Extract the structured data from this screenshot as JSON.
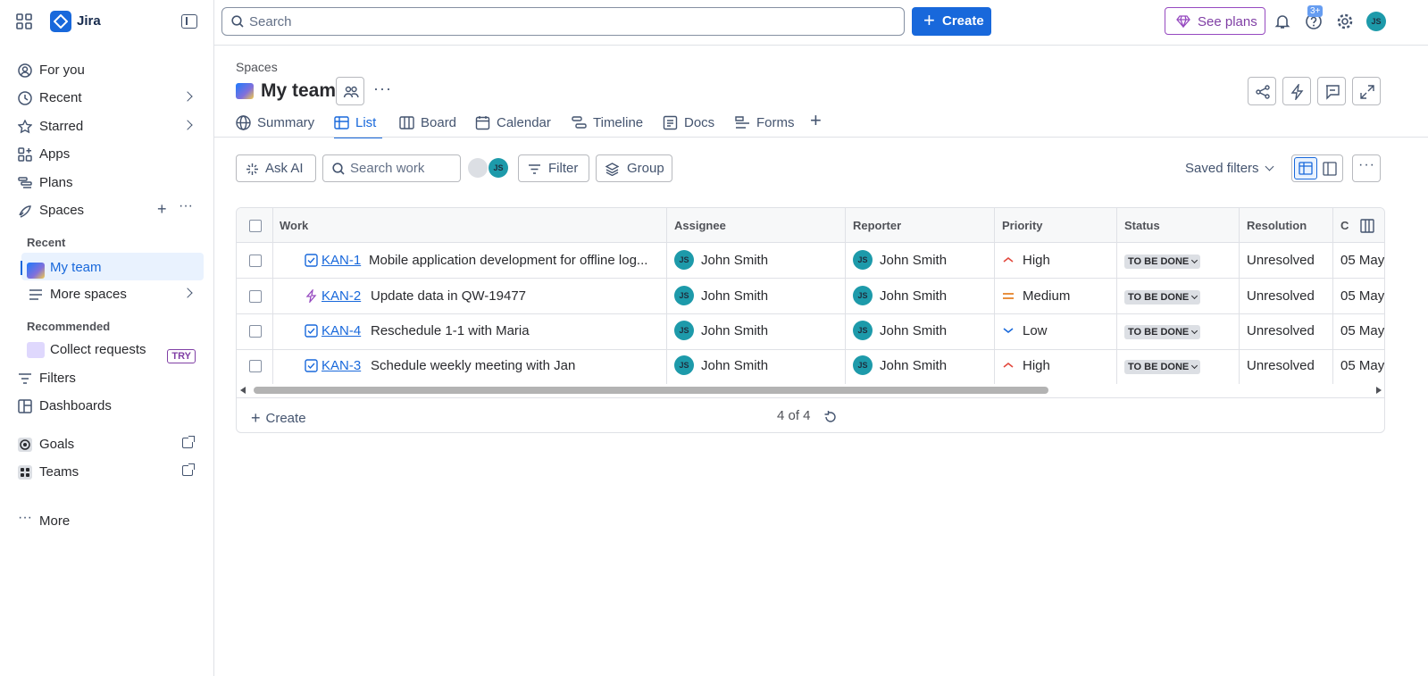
{
  "app": {
    "name": "Jira"
  },
  "sidebar": {
    "items": [
      {
        "label": "For you"
      },
      {
        "label": "Recent"
      },
      {
        "label": "Starred"
      },
      {
        "label": "Apps"
      },
      {
        "label": "Plans"
      },
      {
        "label": "Spaces"
      }
    ],
    "spaces_recent_label": "Recent",
    "current_space": "My team",
    "more_spaces": "More spaces",
    "recommended_label": "Recommended",
    "collect_requests": "Collect requests",
    "try_badge": "TRY",
    "filters": "Filters",
    "dashboards": "Dashboards",
    "goals": "Goals",
    "teams": "Teams",
    "more": "More"
  },
  "topbar": {
    "search_placeholder": "Search",
    "create_label": "Create",
    "see_plans_label": "See plans",
    "help_badge": "3+",
    "user_initials": "JS"
  },
  "page": {
    "breadcrumb": "Spaces",
    "title": "My team",
    "tabs": [
      "Summary",
      "List",
      "Board",
      "Calendar",
      "Timeline",
      "Docs",
      "Forms"
    ],
    "active_tab": "List"
  },
  "toolbar": {
    "ask_ai": "Ask AI",
    "search_work_placeholder": "Search work",
    "filter": "Filter",
    "group": "Group",
    "saved_filters": "Saved filters",
    "avatar_initials": "JS"
  },
  "table": {
    "columns": [
      "Work",
      "Assignee",
      "Reporter",
      "Priority",
      "Status",
      "Resolution",
      "C"
    ],
    "rows": [
      {
        "key": "KAN-1",
        "summary": "Mobile application development for offline log...",
        "type": "task",
        "assignee": "John Smith",
        "reporter": "John Smith",
        "priority": "High",
        "status": "TO BE DONE",
        "resolution": "Unresolved",
        "created": "05 May"
      },
      {
        "key": "KAN-2",
        "summary": "Update data in QW-19477",
        "type": "subtask",
        "assignee": "John Smith",
        "reporter": "John Smith",
        "priority": "Medium",
        "status": "TO BE DONE",
        "resolution": "Unresolved",
        "created": "05 May"
      },
      {
        "key": "KAN-4",
        "summary": "Reschedule 1-1 with Maria",
        "type": "task",
        "assignee": "John Smith",
        "reporter": "John Smith",
        "priority": "Low",
        "status": "TO BE DONE",
        "resolution": "Unresolved",
        "created": "05 May"
      },
      {
        "key": "KAN-3",
        "summary": "Schedule weekly meeting with Jan",
        "type": "task",
        "assignee": "John Smith",
        "reporter": "John Smith",
        "priority": "High",
        "status": "TO BE DONE",
        "resolution": "Unresolved",
        "created": "05 May"
      }
    ],
    "avatar_initials": "JS",
    "create_label": "Create",
    "count": "4 of 4"
  },
  "colors": {
    "accent": "#1868db",
    "premium": "#803fa5",
    "avatar": "#1d9aaa",
    "priority_high": "#e2483d",
    "priority_medium": "#e06c00",
    "priority_low": "#1868db"
  }
}
